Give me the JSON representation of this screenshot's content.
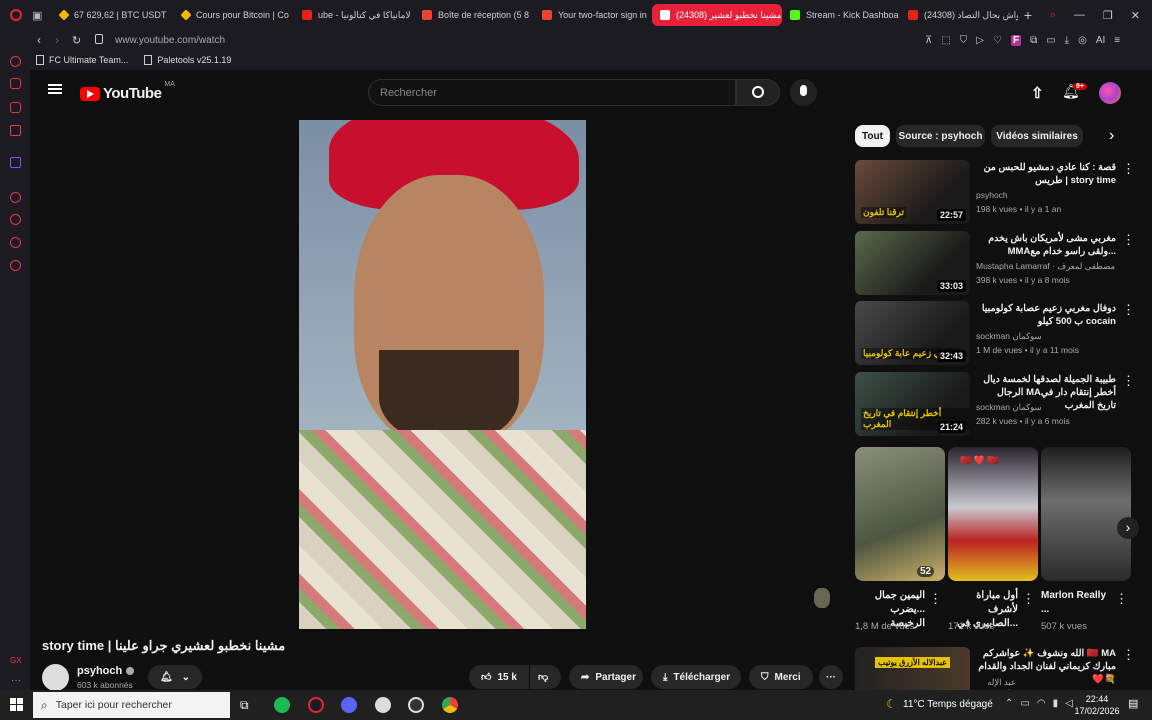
{
  "browser": {
    "tabs": [
      {
        "label": "67 629,62 | BTC USDT",
        "color": "#f0b90b"
      },
      {
        "label": "Cours pour Bitcoin | Co",
        "color": "#f0b90b"
      },
      {
        "label": "ube - لامانياكا في كتالونيا",
        "color": "#e62117"
      },
      {
        "label": "Boîte de réception (5 8",
        "color": "#ea4335"
      },
      {
        "label": "Your two-factor sign in",
        "color": "#ea4335"
      },
      {
        "label": "(24308) مشينا نخطبو لعشير",
        "color": "#e62117"
      },
      {
        "label": "Stream - Kick Dashboa",
        "color": "#53fc18"
      },
      {
        "label": "(24308) واش بحال التصاد",
        "color": "#e62117"
      }
    ],
    "url": "www.youtube.com/watch",
    "bookmarks": [
      "FC Ultimate Team...",
      "Paletools v25.1.19"
    ],
    "ai_label": "AI"
  },
  "youtube": {
    "logo_text": "YouTube",
    "logo_region": "MA",
    "search_placeholder": "Rechercher",
    "notif_count": "9+"
  },
  "video": {
    "title": "story time | مشينا نخطبو لعشيري جراو علينا",
    "channel": "psyhoch",
    "subscribers": "603 k abonnés",
    "likes": "15 k",
    "share_label": "Partager",
    "download_label": "Télécharger",
    "thanks_label": "Merci"
  },
  "chips": [
    "Tout",
    "Source : psyhoch",
    "Vidéos similaires"
  ],
  "recommendations": [
    {
      "title": "قصة : كنا عادي دمشيو للحبس من طريس | story time",
      "channel": "psyhoch",
      "views": "198 k vues",
      "age": "il y a 1 an",
      "duration": "22:57",
      "thumb_text": "ترقنا تلفون",
      "color": "#6b4a3a"
    },
    {
      "title": "مغربي مشى لأمريكان باش يخدم MMAولقى راسو خدام مع...",
      "channel": "Mustapha Lamarraf · مصطفى لمعرف",
      "views": "398 k vues",
      "age": "il y a 8 mois",
      "duration": "33:03",
      "thumb_text": "",
      "color": "#5b6a4a"
    },
    {
      "title": "دوفال مغربي زعيم عصابة كولومبيا ب 500 كيلو cocain",
      "channel": "sockman سوكمان",
      "views": "1 M de vues",
      "age": "il y a 11 mois",
      "duration": "32:43",
      "thumb_text": "مغربي زعيم عابة كولومبيا",
      "color": "#4a4a4a"
    },
    {
      "title": "طبيبة الجميلة لصدقها لخمسة ديال الرجال MAأخطر إنتقام دار في تاريخ المغرب",
      "channel": "sockman سوكمان",
      "views": "282 k vues",
      "age": "il y a 6 mois",
      "duration": "21:24",
      "thumb_text": "أخطر إنتقام في تاريخ المغرب",
      "color": "#3d5248"
    }
  ],
  "shorts": [
    {
      "title": "اليمين جمال ...يضرب الرخيصة",
      "views": "1,8 M de vues",
      "overlay": "52"
    },
    {
      "title": "أول مباراة لأشرف ...الصابيري في",
      "views": "171 k vues",
      "overlay": "🇲🇦 ❤️ 🇲🇦"
    },
    {
      "title": "Marlon Really ...",
      "views": "507 k vues",
      "overlay": ""
    }
  ],
  "bottom_rec": {
    "title": "الله ونشوف ✨ عواشركم 🇲🇦 MA مبارك كريماني لفنان الجداد والقدام❤️💐",
    "channel": "عبد الإله الأزرق",
    "thumb_text": "عبدالاله الأزرق يوتيب"
  },
  "taskbar": {
    "search_placeholder": "Taper ici pour rechercher",
    "weather": "11°C  Temps dégagé",
    "time": "22:44",
    "date": "17/02/2026"
  },
  "colors": {
    "accent": "#e8213a",
    "youtube_red": "#ff0000"
  }
}
